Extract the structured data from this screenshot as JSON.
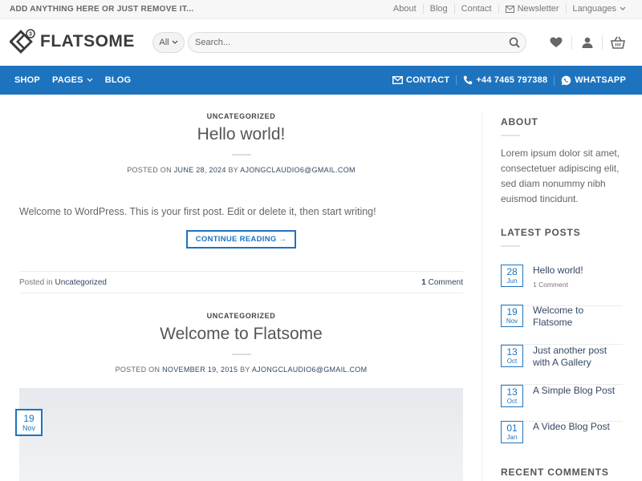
{
  "topbar": {
    "promo": "ADD ANYTHING HERE OR JUST REMOVE IT...",
    "links": [
      "About",
      "Blog",
      "Contact",
      "Newsletter",
      "Languages"
    ]
  },
  "header": {
    "logo_text": "FLATSOME",
    "category": "All",
    "search_placeholder": "Search..."
  },
  "nav": {
    "left": [
      "SHOP",
      "PAGES",
      "BLOG"
    ],
    "contact": "CONTACT",
    "phone": "+44 7465 797388",
    "whatsapp": "WHATSAPP"
  },
  "posts": [
    {
      "category": "UNCATEGORIZED",
      "title": "Hello world!",
      "posted_on_label": "POSTED ON",
      "date": "JUNE 28, 2024",
      "by_label": "BY",
      "author": "AJONGCLAUDIO6@GMAIL.COM",
      "excerpt": "Welcome to WordPress. This is your first post. Edit or delete it, then start writing!",
      "button": "CONTINUE READING →",
      "posted_in_label": "Posted in",
      "posted_in": "Uncategorized",
      "comments_count": "1",
      "comments_label": "Comment"
    },
    {
      "category": "UNCATEGORIZED",
      "title": "Welcome to Flatsome",
      "posted_on_label": "POSTED ON",
      "date": "NOVEMBER 19, 2015",
      "by_label": "BY",
      "author": "AJONGCLAUDIO6@GMAIL.COM",
      "badge_day": "19",
      "badge_month": "Nov"
    }
  ],
  "sidebar": {
    "about_title": "ABOUT",
    "about_text": "Lorem ipsum dolor sit amet, consectetuer adipiscing elit, sed diam nonummy nibh euismod tincidunt.",
    "latest_title": "LATEST POSTS",
    "latest_posts": [
      {
        "day": "28",
        "month": "Jun",
        "title": "Hello world!",
        "comments": "1 Comment"
      },
      {
        "day": "19",
        "month": "Nov",
        "title": "Welcome to Flatsome"
      },
      {
        "day": "13",
        "month": "Oct",
        "title": "Just another post with A Gallery"
      },
      {
        "day": "13",
        "month": "Oct",
        "title": "A Simple Blog Post"
      },
      {
        "day": "01",
        "month": "Jan",
        "title": "A Video Blog Post"
      }
    ],
    "recent_comments_title": "RECENT COMMENTS"
  },
  "colors": {
    "accent": "#1e73be",
    "link": "#334862"
  }
}
